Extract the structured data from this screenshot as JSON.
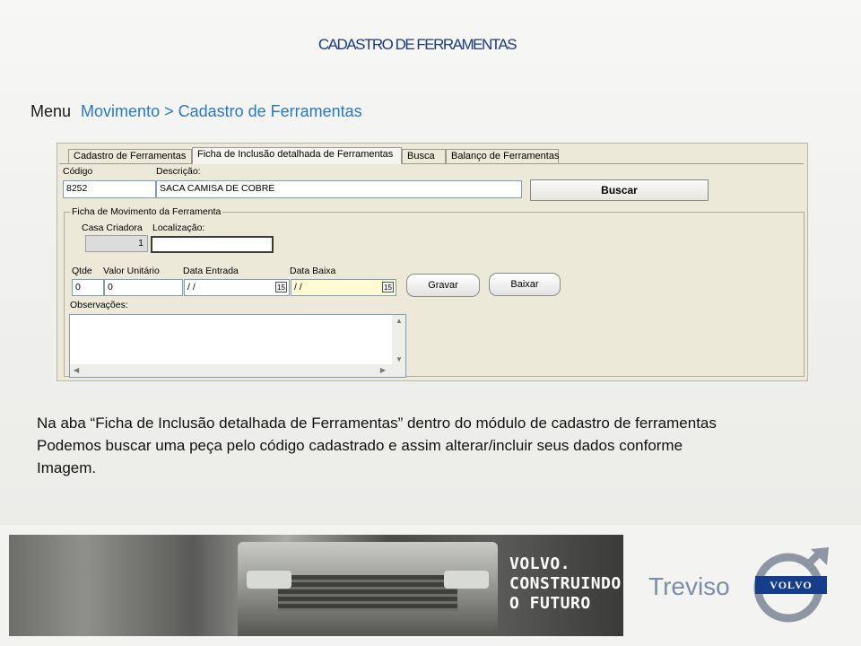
{
  "page": {
    "title": "CADASTRO DE FERRAMENTAS"
  },
  "menu": {
    "prefix": "Menu",
    "path": "Movimento > Cadastro de Ferramentas"
  },
  "app": {
    "tabs": [
      {
        "label": "Cadastro de Ferramentas"
      },
      {
        "label": "Ficha de Inclusão detalhada de Ferramentas",
        "active": true
      },
      {
        "label": "Busca"
      },
      {
        "label": "Balanço de Ferramentas"
      }
    ],
    "codigo": {
      "label": "Código",
      "value": "8252"
    },
    "descricao": {
      "label": "Descrição:",
      "value": "SACA CAMISA DE COBRE"
    },
    "buscar_label": "Buscar",
    "ficha": {
      "legend": "Ficha de Movimento da Ferramenta",
      "casa_criadora": {
        "label": "Casa Criadora",
        "value": "1"
      },
      "localizacao": {
        "label": "Localização:",
        "value": ""
      },
      "qtde": {
        "label": "Qtde",
        "value": "0"
      },
      "valor_unitario": {
        "label": "Valor Unitário",
        "value": "0"
      },
      "data_entrada": {
        "label": "Data Entrada",
        "value": "/ /",
        "cal": "15"
      },
      "data_baixa": {
        "label": "Data Baixa",
        "value": "/ /",
        "cal": "15"
      },
      "gravar_label": "Gravar",
      "baixar_label": "Baixar",
      "observacoes": {
        "label": "Observações:",
        "value": ""
      }
    }
  },
  "caption": {
    "line1": "Na aba “Ficha de Inclusão detalhada de Ferramentas” dentro do módulo de cadastro de ferramentas",
    "line2": "Podemos buscar uma peça pelo código cadastrado e assim alterar/incluir seus dados conforme",
    "line3": "Imagem."
  },
  "footer": {
    "slogan_1": "VOLVO.",
    "slogan_2": "CONSTRUINDO",
    "slogan_3": "O FUTURO",
    "dealer": "Treviso",
    "brand": "VOLVO"
  }
}
